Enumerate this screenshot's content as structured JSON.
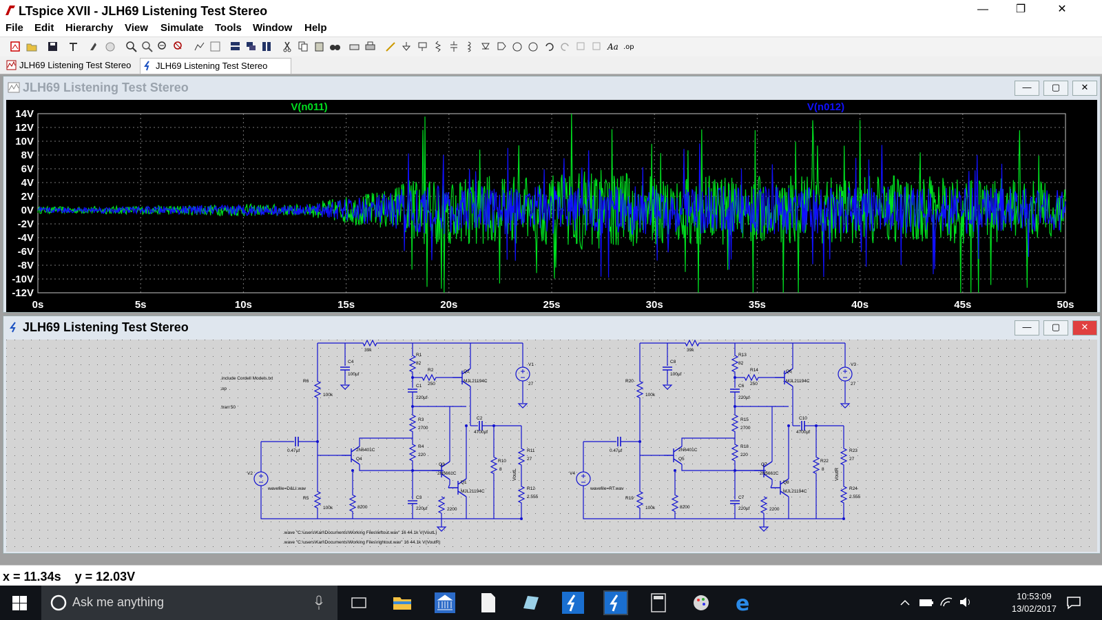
{
  "window": {
    "title": "LTspice XVII - JLH69 Listening Test Stereo",
    "minimize": "—",
    "restore": "❐",
    "close": "✕"
  },
  "menu": [
    "File",
    "Edit",
    "Hierarchy",
    "View",
    "Simulate",
    "Tools",
    "Window",
    "Help"
  ],
  "tabs": [
    {
      "label": "JLH69 Listening Test Stereo",
      "icon": "waveform-icon"
    },
    {
      "label": "JLH69 Listening Test Stereo",
      "icon": "schematic-icon"
    }
  ],
  "waveform_window": {
    "title": "JLH69 Listening Test Stereo",
    "traces": [
      {
        "name": "V(n011)",
        "color": "#00e020"
      },
      {
        "name": "V(n012)",
        "color": "#1010ff"
      }
    ]
  },
  "schematic_window": {
    "title": "JLH69 Listening Test Stereo",
    "directives": [
      ".include Cordell Models.txt",
      ";op",
      ".tran 50"
    ],
    "wave_lines": [
      ".wave \"C:\\users\\Karl\\Documents\\Working Files\\leftout.wav\" 16 44.1k V(VoutL)",
      ".wave \"C:\\users\\Karl\\Documents\\Working Files\\rightout.wav\" 16 44.1k V(VoutR)"
    ],
    "left": {
      "R_top": "39k",
      "C4": "C4",
      "C4v": "100µf",
      "R1": "R1",
      "R1v": "82",
      "R2": "R2",
      "R2v": "250",
      "Q2": "Q2",
      "Q2m": "MJL21194C",
      "V1": "V1",
      "V1v": "27",
      "R6": "R6",
      "R6v": "100k",
      "C1": "C1",
      "C1v": "220µf",
      "R3": "R3",
      "R3v": "2700",
      "C2": "C2",
      "C2v": "4700µf",
      "Cin": "0.47µf",
      "Q4m": "2N6401C",
      "Q4": "Q4",
      "R4": "R4",
      "R4v": "220",
      "R11": "R11",
      "R11v": "27",
      "R10": "R10",
      "R10v": "8",
      "Vout": "VoutL",
      "V2": "V2",
      "Q3": "Q3",
      "Q3m": "2N5661C",
      "Q1": "Q1",
      "Q1m": "MJL21194C",
      "R12": "R12",
      "R12v": "2.555",
      "wavefile": "wavefile=D&LI.wav",
      "R5": "R5",
      "R5v": "100k",
      "Rb": "8200",
      "C3": "C3",
      "C3v": "220µf",
      "Re": "2200"
    },
    "right": {
      "R_top": "39k",
      "C4": "C8",
      "C4v": "100µf",
      "R1": "R13",
      "R1v": "82",
      "R2": "R14",
      "R2v": "250",
      "Q2": "Q6",
      "Q2m": "MJL21194C",
      "V1": "V3",
      "V1v": "27",
      "R6": "R20",
      "R6v": "100k",
      "C1": "C6",
      "C1v": "220µf",
      "R3": "R15",
      "R3v": "2700",
      "C2": "C10",
      "C2v": "4700µf",
      "Cin": "0.47µf",
      "Q4m": "2N6401C",
      "Q4": "Q5",
      "R4": "R18",
      "R4v": "220",
      "R11": "R23",
      "R11v": "27",
      "R10": "R22",
      "R10v": "8",
      "Vout": "VoutR",
      "V2": "V4",
      "Q3": "Q7",
      "Q3m": "2N5661C",
      "Q1": "Q8",
      "Q1m": "MJL21194C",
      "R12": "R24",
      "R12v": "2.555",
      "wavefile": "wavefile=RT.wav",
      "R5": "R19",
      "R5v": "100k",
      "Rb": "8200",
      "C3": "C7",
      "C3v": "220µf",
      "Re": "2200"
    }
  },
  "chart_data": {
    "type": "line",
    "title": "",
    "xlabel": "",
    "ylabel": "",
    "xlim": [
      0,
      50
    ],
    "ylim": [
      -12,
      14
    ],
    "x_ticks": [
      "0s",
      "5s",
      "10s",
      "15s",
      "20s",
      "25s",
      "30s",
      "35s",
      "40s",
      "45s",
      "50s"
    ],
    "y_ticks": [
      "14V",
      "12V",
      "10V",
      "8V",
      "6V",
      "4V",
      "2V",
      "0V",
      "-2V",
      "-4V",
      "-6V",
      "-8V",
      "-10V",
      "-12V"
    ],
    "grid": true,
    "series": [
      {
        "name": "V(n011)",
        "color": "#00e020",
        "envelope_t": [
          0,
          5,
          10,
          13,
          14,
          17,
          18,
          20,
          25,
          27,
          30,
          32,
          35,
          40,
          45,
          50
        ],
        "envelope_v": [
          0.5,
          0.6,
          0.9,
          0.8,
          1.5,
          3,
          5,
          5,
          5,
          6,
          5,
          5,
          5,
          5,
          5,
          4
        ]
      },
      {
        "name": "V(n012)",
        "color": "#1010ff",
        "envelope_t": [
          0,
          5,
          10,
          13,
          14,
          17,
          18,
          20,
          25,
          27,
          30,
          32,
          35,
          40,
          45,
          50
        ],
        "envelope_v": [
          0.4,
          0.5,
          0.8,
          0.7,
          1.2,
          2.5,
          3.5,
          3.5,
          3.5,
          3.5,
          3.5,
          3.5,
          3.5,
          3.5,
          3.5,
          3
        ]
      }
    ]
  },
  "status": "x = 11.34s    y = 12.03V",
  "taskbar": {
    "search": "Ask me anything",
    "time": "10:53:09",
    "date": "13/02/2017"
  }
}
